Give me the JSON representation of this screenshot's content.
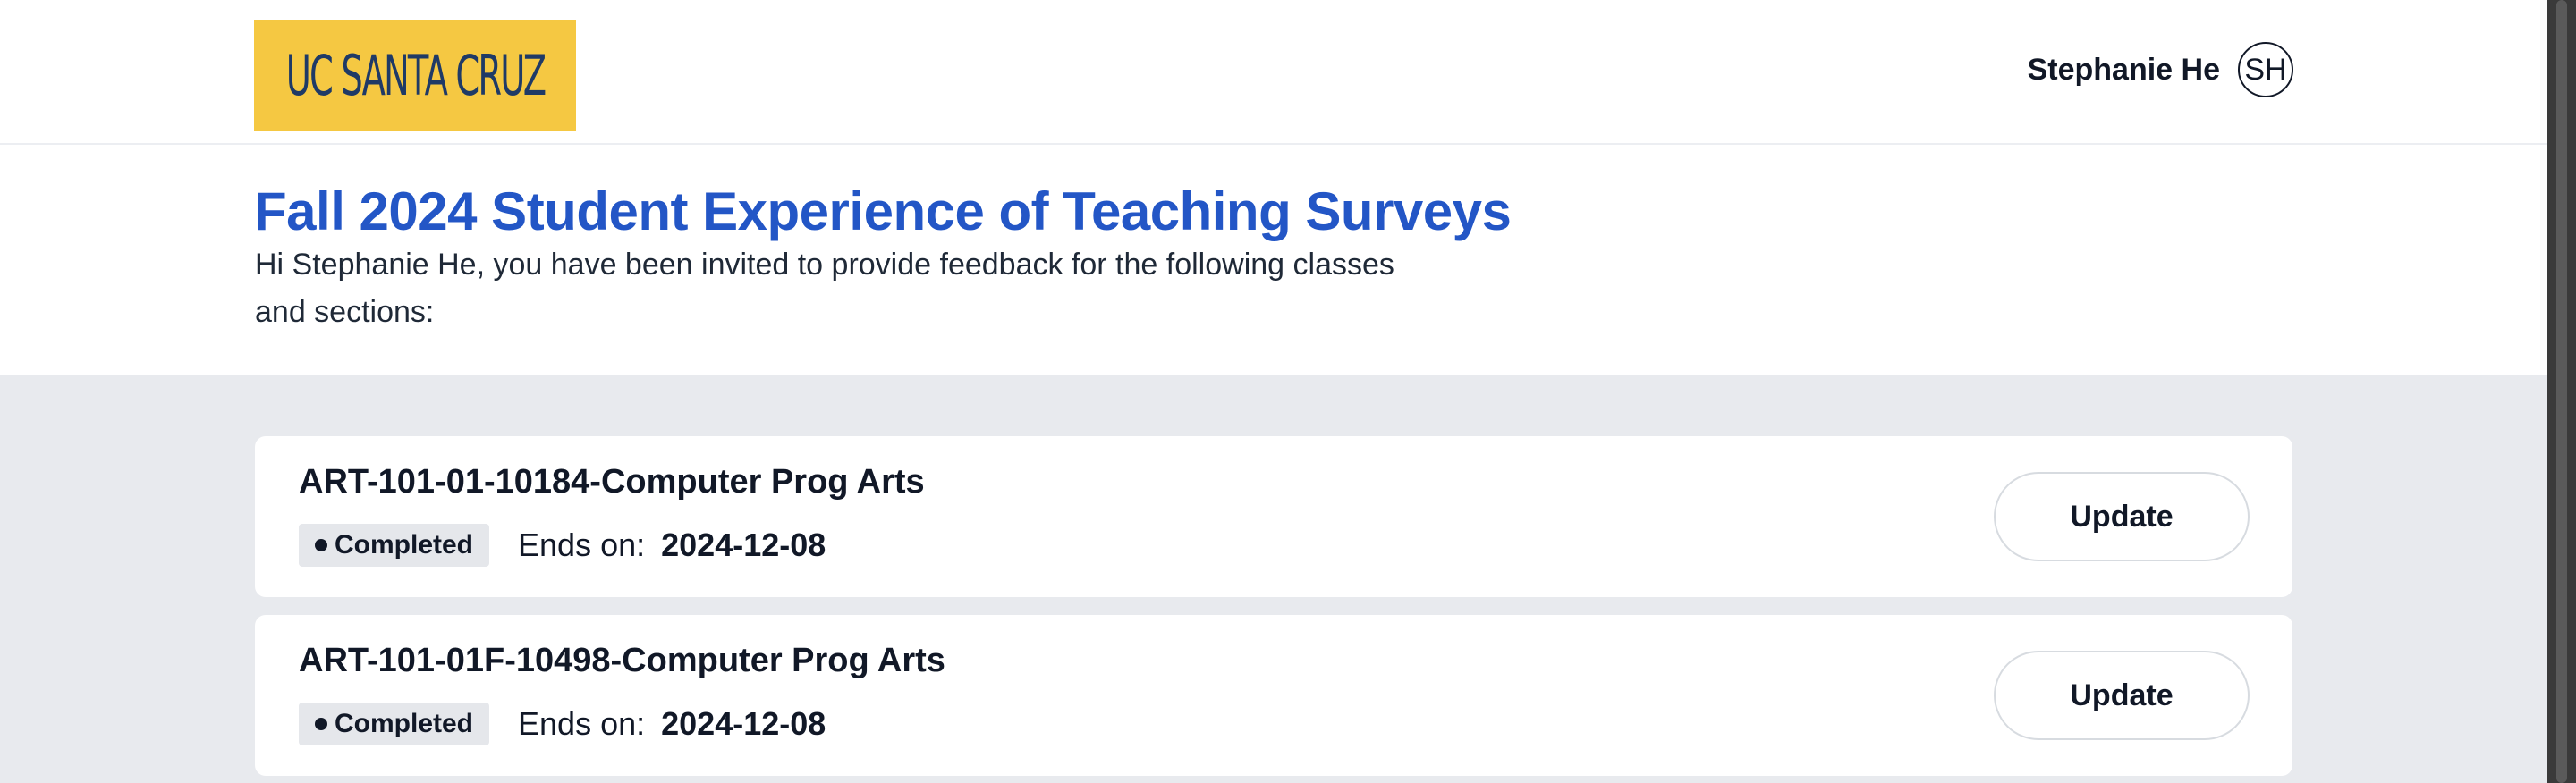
{
  "header": {
    "logo_text": "UC SANTA CRUZ",
    "user_name": "Stephanie He",
    "user_initials": "SH"
  },
  "intro": {
    "title": "Fall 2024 Student Experience of Teaching Surveys",
    "text": "Hi Stephanie He, you have been invited to provide feedback for the following classes and sections:"
  },
  "surveys": [
    {
      "title": "ART-101-01-10184-Computer Prog Arts",
      "status": "Completed",
      "ends_label": "Ends on:",
      "ends_date": "2024-12-08",
      "button_label": "Update"
    },
    {
      "title": "ART-101-01F-10498-Computer Prog Arts",
      "status": "Completed",
      "ends_label": "Ends on:",
      "ends_date": "2024-12-08",
      "button_label": "Update"
    }
  ],
  "colors": {
    "brand_gold": "#f5c842",
    "brand_navy": "#1f3a66",
    "title_blue": "#2356c6",
    "list_background": "#e8eaee"
  }
}
